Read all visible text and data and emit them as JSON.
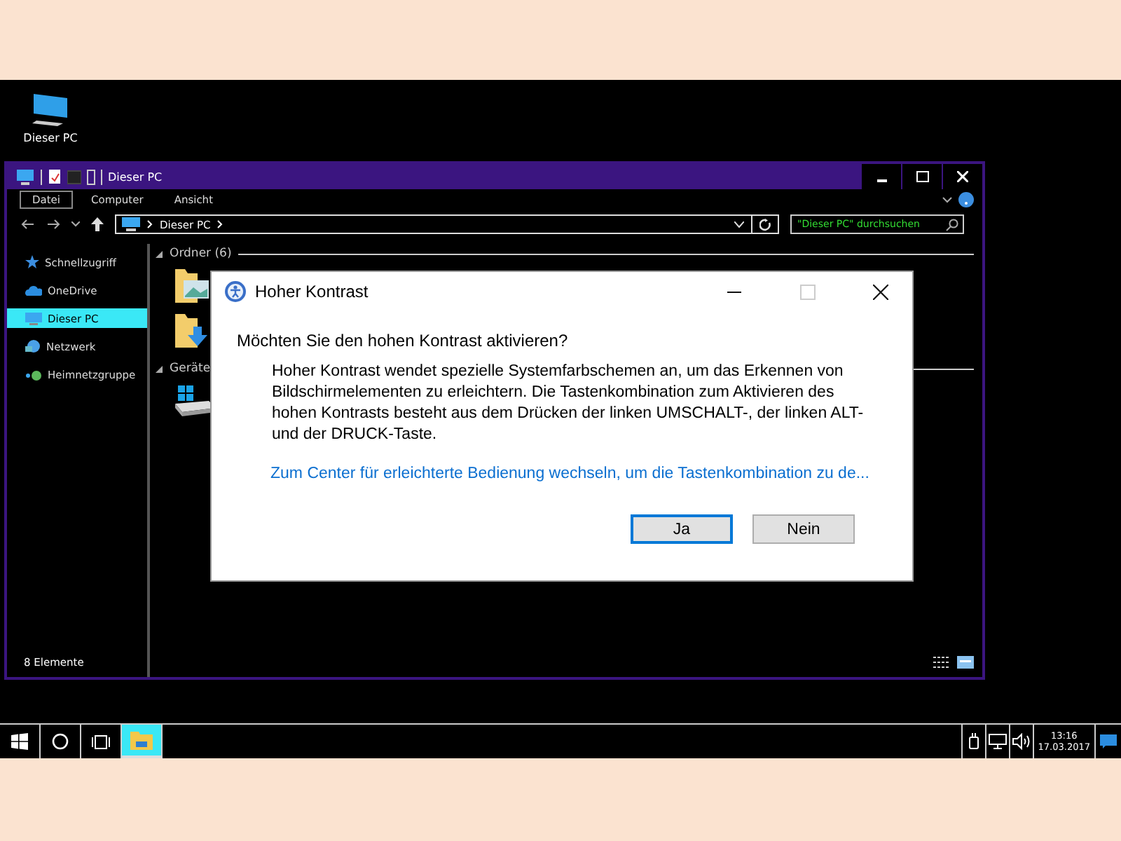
{
  "desktop": {
    "icons": [
      {
        "label": "Dieser PC"
      }
    ]
  },
  "explorer": {
    "title": "Dieser PC",
    "ribbon_tabs": [
      {
        "label": "Datei",
        "selected": true
      },
      {
        "label": "Computer",
        "selected": false
      },
      {
        "label": "Ansicht",
        "selected": false
      }
    ],
    "address": [
      "Dieser PC"
    ],
    "search": {
      "placeholder": "\"Dieser PC\" durchsuchen"
    },
    "nav": [
      {
        "label": "Schnellzugriff",
        "kind": "star",
        "selected": false
      },
      {
        "label": "OneDrive",
        "kind": "cloud",
        "selected": false
      },
      {
        "label": "Dieser PC",
        "kind": "pc",
        "selected": true
      },
      {
        "label": "Netzwerk",
        "kind": "network",
        "selected": false
      },
      {
        "label": "Heimnetzgruppe",
        "kind": "homegroup",
        "selected": false
      }
    ],
    "sections": [
      {
        "title": "Ordner (6)",
        "items": [
          {
            "kind": "pictures"
          },
          {
            "kind": "downloads"
          }
        ]
      },
      {
        "title": "Geräte",
        "items": [
          {
            "kind": "drive"
          }
        ]
      }
    ],
    "status": "8 Elemente"
  },
  "dialog": {
    "title": "Hoher Kontrast",
    "heading": "Möchten Sie den hohen Kontrast aktivieren?",
    "body": "Hoher Kontrast wendet spezielle Systemfarbschemen an, um das Erkennen von Bildschirmelementen zu erleichtern. Die Tastenkombination zum Aktivieren des hohen Kontrasts besteht aus dem Drücken der linken UMSCHALT-, der linken ALT- und der DRUCK-Taste.",
    "link": "Zum Center für erleichterte Bedienung wechseln, um die Tastenkombination zu de...",
    "buttons": [
      {
        "label": "Ja",
        "selected": true
      },
      {
        "label": "Nein",
        "selected": false
      }
    ]
  },
  "taskbar": {
    "apps": [
      {
        "kind": "start",
        "selected": false
      },
      {
        "kind": "search",
        "selected": false
      },
      {
        "kind": "taskview",
        "selected": false
      },
      {
        "kind": "explorer",
        "selected": true
      }
    ],
    "time": "13:16",
    "date": "17.03.2017"
  }
}
